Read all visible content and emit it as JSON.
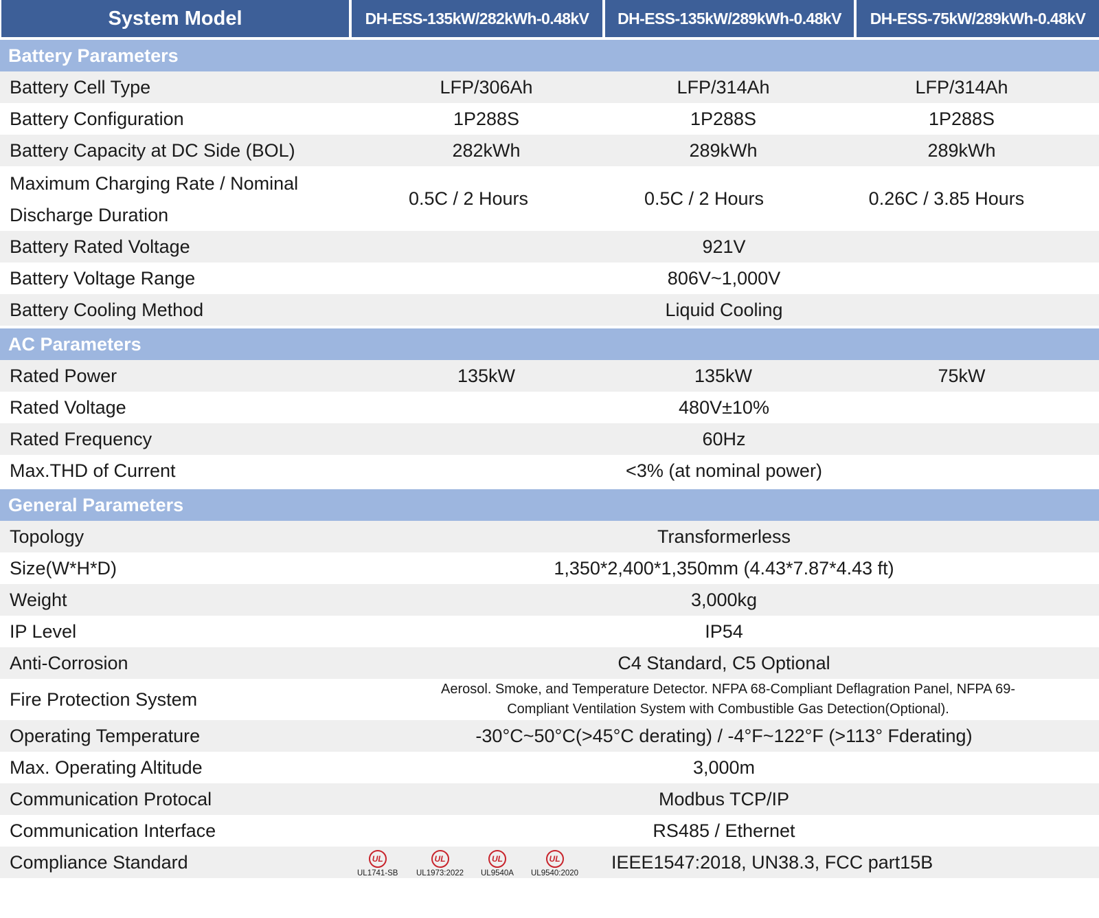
{
  "header": {
    "model_label": "System Model",
    "models": [
      "DH-ESS-135kW/282kWh-0.48kV",
      "DH-ESS-135kW/289kWh-0.48kV",
      "DH-ESS-75kW/289kWh-0.48kV"
    ]
  },
  "battery": {
    "title": "Battery Parameters",
    "cell_type": {
      "label": "Battery Cell Type",
      "values": [
        "LFP/306Ah",
        "LFP/314Ah",
        "LFP/314Ah"
      ]
    },
    "configuration": {
      "label": "Battery Configuration",
      "values": [
        "1P288S",
        "1P288S",
        "1P288S"
      ]
    },
    "capacity": {
      "label": "Battery Capacity at DC Side (BOL)",
      "values": [
        "282kWh",
        "289kWh",
        "289kWh"
      ]
    },
    "charge_rate": {
      "label_line1": "Maximum Charging Rate / Nominal",
      "label_line2": "Discharge Duration",
      "values": [
        "0.5C / 2 Hours",
        "0.5C / 2 Hours",
        "0.26C / 3.85 Hours"
      ]
    },
    "rated_voltage": {
      "label": "Battery Rated Voltage",
      "value": "921V"
    },
    "voltage_range": {
      "label": "Battery Voltage Range",
      "value": "806V~1,000V"
    },
    "cooling": {
      "label": "Battery Cooling Method",
      "value": "Liquid Cooling"
    }
  },
  "ac": {
    "title": "AC Parameters",
    "rated_power": {
      "label": "Rated Power",
      "values": [
        "135kW",
        "135kW",
        "75kW"
      ]
    },
    "rated_voltage": {
      "label": "Rated Voltage",
      "value": "480V±10%"
    },
    "rated_frequency": {
      "label": "Rated Frequency",
      "value": "60Hz"
    },
    "thd": {
      "label": "Max.THD of Current",
      "value": "<3% (at nominal power)"
    }
  },
  "general": {
    "title": "General Parameters",
    "topology": {
      "label": "Topology",
      "value": "Transformerless"
    },
    "size": {
      "label": "Size(W*H*D)",
      "value": "1,350*2,400*1,350mm (4.43*7.87*4.43 ft)"
    },
    "weight": {
      "label": "Weight",
      "value": "3,000kg"
    },
    "ip": {
      "label": "IP Level",
      "value": "IP54"
    },
    "corrosion": {
      "label": "Anti-Corrosion",
      "value": "C4 Standard, C5 Optional"
    },
    "fire": {
      "label": "Fire Protection System",
      "line1": "Aerosol. Smoke, and Temperature Detector. NFPA 68-Compliant Deflagration Panel, NFPA 69-",
      "line2": "Compliant Ventilation System with Combustible Gas Detection(Optional)."
    },
    "op_temp": {
      "label": "Operating Temperature",
      "value": "-30°C~50°C(>45°C derating) / -4°F~122°F (>113° Fderating)"
    },
    "altitude": {
      "label": "Max. Operating Altitude",
      "value": "3,000m"
    },
    "protocol": {
      "label": "Communication Protocal",
      "value": "Modbus TCP/IP"
    },
    "interface": {
      "label": "Communication Interface",
      "value": "RS485 / Ethernet"
    },
    "compliance": {
      "label": "Compliance Standard",
      "ul_mark": "UL",
      "certs": [
        "UL1741-SB",
        "UL1973:2022",
        "UL9540A",
        "UL9540:2020"
      ],
      "value": "IEEE1547:2018, UN38.3, FCC part15B"
    }
  },
  "colors": {
    "header_bg": "#3d5f98",
    "section_bg": "#9db6df",
    "stripe_bg": "#efefef",
    "ul_red": "#c8242c"
  }
}
